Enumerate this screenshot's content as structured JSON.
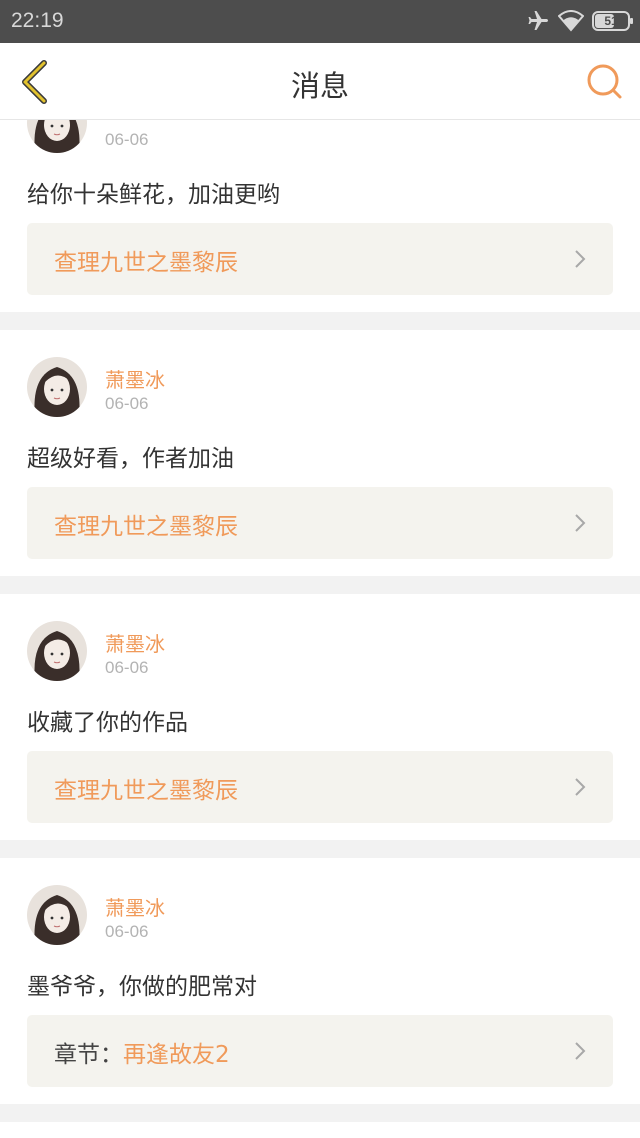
{
  "status_bar": {
    "time": "22:19",
    "battery": "51",
    "icons": [
      "airplane-icon",
      "wifi-icon",
      "battery-icon"
    ]
  },
  "nav": {
    "title": "消息",
    "back_icon": "chevron-left-icon",
    "search_icon": "search-icon"
  },
  "colors": {
    "accent": "#f09a5a",
    "back_icon": "#d8b52a",
    "link_bg": "#f4f3ee"
  },
  "messages": [
    {
      "username": "",
      "date": "06-06",
      "comment": "给你十朵鲜花，加油更哟",
      "link_prefix": "",
      "link_text": "查理九世之墨黎辰"
    },
    {
      "username": "萧墨冰",
      "date": "06-06",
      "comment": "超级好看，作者加油",
      "link_prefix": "",
      "link_text": "查理九世之墨黎辰"
    },
    {
      "username": "萧墨冰",
      "date": "06-06",
      "comment": "收藏了你的作品",
      "link_prefix": "",
      "link_text": "查理九世之墨黎辰"
    },
    {
      "username": "萧墨冰",
      "date": "06-06",
      "comment": "墨爷爷，你做的肥常对",
      "link_prefix": "章节：",
      "link_text": "再逢故友2"
    }
  ]
}
